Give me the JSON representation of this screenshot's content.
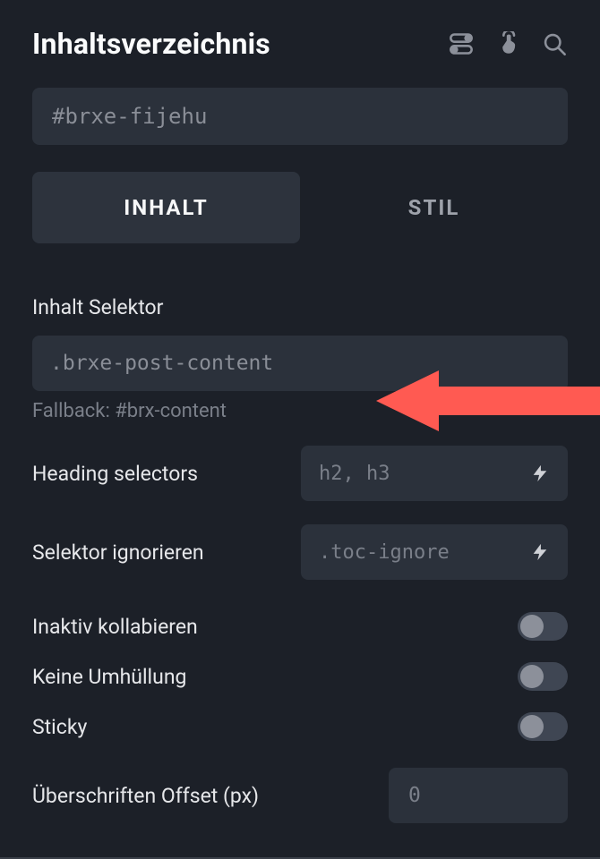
{
  "header": {
    "title": "Inhaltsverzeichnis"
  },
  "idField": {
    "value": "#brxe-fijehu"
  },
  "tabs": {
    "content": "INHALT",
    "style": "STIL"
  },
  "contentSelector": {
    "label": "Inhalt Selektor",
    "value": ".brxe-post-content",
    "fallback": "Fallback: #brx-content"
  },
  "headingSelectors": {
    "label": "Heading selectors",
    "placeholder": "h2, h3"
  },
  "ignoreSelector": {
    "label": "Selektor ignorieren",
    "placeholder": ".toc-ignore"
  },
  "toggles": {
    "collapse": "Inaktiv kollabieren",
    "nowrap": "Keine Umhüllung",
    "sticky": "Sticky"
  },
  "offset": {
    "label": "Überschriften Offset (px)",
    "placeholder": "0"
  }
}
